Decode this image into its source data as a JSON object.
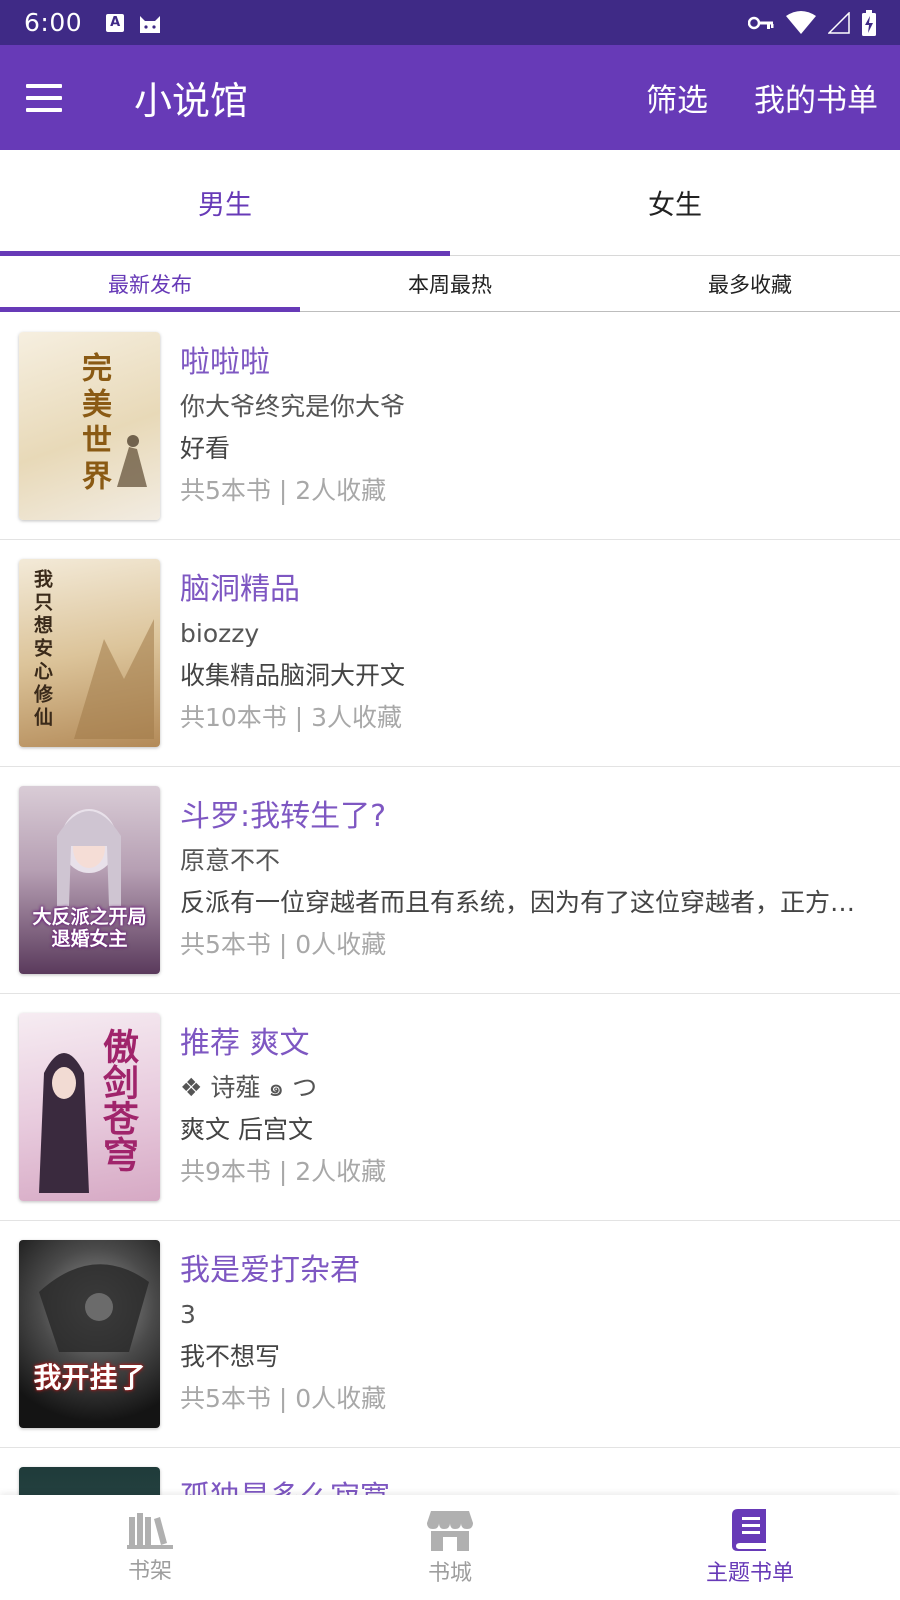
{
  "status_bar": {
    "time": "6:00",
    "a_icon_text": "A"
  },
  "app_bar": {
    "title": "小说馆",
    "actions": [
      "筛选",
      "我的书单"
    ]
  },
  "gender_tabs": [
    {
      "label": "男生",
      "active": true
    },
    {
      "label": "女生",
      "active": false
    }
  ],
  "sort_tabs": [
    {
      "label": "最新发布",
      "active": true
    },
    {
      "label": "本周最热",
      "active": false
    },
    {
      "label": "最多收藏",
      "active": false
    }
  ],
  "book_lists": [
    {
      "title": "啦啦啦",
      "author": "你大爷终究是你大爷",
      "description": "好看",
      "stats": "共5本书 |  2人收藏",
      "cover_text": "完美世界",
      "cover_colors": [
        "#f3ead7",
        "#d9c7a0"
      ]
    },
    {
      "title": "脑洞精品",
      "author": "biozzy",
      "description": "收集精品脑洞大开文",
      "stats": "共10本书 |  3人收藏",
      "cover_text": "我只想安心修仙",
      "cover_colors": [
        "#efe4cf",
        "#c7a772"
      ]
    },
    {
      "title": "斗罗:我转生了?",
      "author": "原意不不",
      "description": "反派有一位穿越者而且有系统，因为有了这位穿越者，正方的人都被他杀了",
      "stats": "共5本书 |  0人收藏",
      "cover_text": "大反派之开局退婚女主",
      "cover_colors": [
        "#cbbcc8",
        "#6b4a6e"
      ]
    },
    {
      "title": "推荐 爽文",
      "author": "❖ 诗薤 ๑ つ",
      "description": "爽文 后宫文",
      "stats": "共9本书 |  2人收藏",
      "cover_text": "傲剑苍穹",
      "cover_colors": [
        "#f4e6ee",
        "#a23b7a"
      ]
    },
    {
      "title": "我是爱打杂君",
      "author": "3",
      "description": "我不想写",
      "stats": "共5本书 |  0人收藏",
      "cover_text": "我开挂了",
      "cover_colors": [
        "#2b2b2b",
        "#8d8d8d"
      ]
    },
    {
      "title": "孤独是多么寂寞",
      "author": "",
      "description": "",
      "stats": "",
      "cover_text": "",
      "cover_colors": [
        "#1f3b3a",
        "#3c5f5c"
      ]
    }
  ],
  "bottom_nav": [
    {
      "label": "书架",
      "icon": "bookshelf-icon",
      "active": false
    },
    {
      "label": "书城",
      "icon": "store-icon",
      "active": false
    },
    {
      "label": "主题书单",
      "icon": "booklist-icon",
      "active": true
    }
  ],
  "colors": {
    "status_bar": "#3f2a86",
    "app_bar": "#673ab7",
    "accent": "#673ab7",
    "title_text": "#7e57c2",
    "stats_text": "#a8a8a8"
  }
}
